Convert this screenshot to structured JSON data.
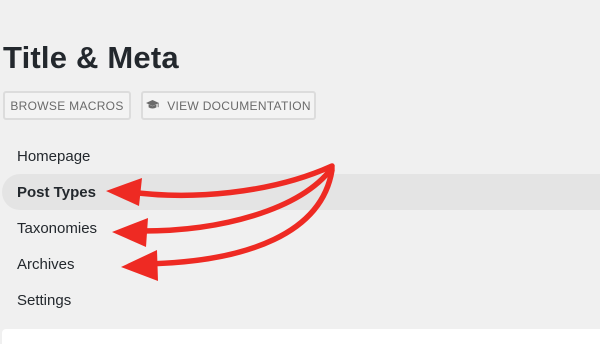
{
  "header": {
    "title": "Title & Meta"
  },
  "toolbar": {
    "browse_macros_label": "BROWSE MACROS",
    "view_docs_label": "VIEW DOCUMENTATION",
    "view_docs_icon": "graduation-cap-icon"
  },
  "menu": {
    "items": [
      {
        "label": "Homepage",
        "active": false
      },
      {
        "label": "Post Types",
        "active": true
      },
      {
        "label": "Taxonomies",
        "active": false
      },
      {
        "label": "Archives",
        "active": false
      },
      {
        "label": "Settings",
        "active": false
      }
    ]
  },
  "annotation": {
    "arrow_color": "#ee2a23"
  }
}
